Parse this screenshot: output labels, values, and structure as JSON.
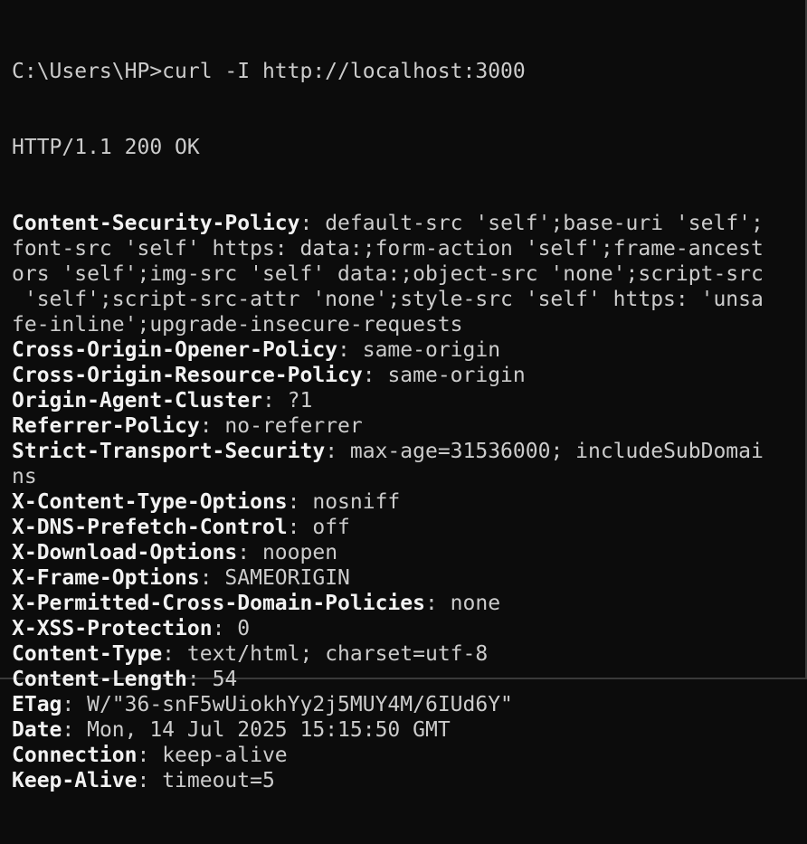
{
  "terminal": {
    "command_line": "C:\\Users\\HP>curl -I http://localhost:3000",
    "status_line": "HTTP/1.1 200 OK",
    "headers": [
      {
        "key": "Content-Security-Policy",
        "sep": ": ",
        "lines": [
          "default-src 'self';base-uri 'self';",
          "font-src 'self' https: data:;form-action 'self';frame-ancest",
          "ors 'self';img-src 'self' data:;object-src 'none';script-src",
          " 'self';script-src-attr 'none';style-src 'self' https: 'unsa",
          "fe-inline';upgrade-insecure-requests"
        ]
      },
      {
        "key": "Cross-Origin-Opener-Policy",
        "sep": ": ",
        "lines": [
          "same-origin"
        ]
      },
      {
        "key": "Cross-Origin-Resource-Policy",
        "sep": ": ",
        "lines": [
          "same-origin"
        ]
      },
      {
        "key": "Origin-Agent-Cluster",
        "sep": ": ",
        "lines": [
          "?1"
        ]
      },
      {
        "key": "Referrer-Policy",
        "sep": ": ",
        "lines": [
          "no-referrer"
        ]
      },
      {
        "key": "Strict-Transport-Security",
        "sep": ": ",
        "lines": [
          "max-age=31536000; includeSubDomai",
          "ns"
        ]
      },
      {
        "key": "X-Content-Type-Options",
        "sep": ": ",
        "lines": [
          "nosniff"
        ]
      },
      {
        "key": "X-DNS-Prefetch-Control",
        "sep": ": ",
        "lines": [
          "off"
        ]
      },
      {
        "key": "X-Download-Options",
        "sep": ": ",
        "lines": [
          "noopen"
        ]
      },
      {
        "key": "X-Frame-Options",
        "sep": ": ",
        "lines": [
          "SAMEORIGIN"
        ]
      },
      {
        "key": "X-Permitted-Cross-Domain-Policies",
        "sep": ": ",
        "lines": [
          "none"
        ]
      },
      {
        "key": "X-XSS-Protection",
        "sep": ": ",
        "lines": [
          "0"
        ]
      },
      {
        "key": "Content-Type",
        "sep": ": ",
        "lines": [
          "text/html; charset=utf-8"
        ]
      },
      {
        "key": "Content-Length",
        "sep": ": ",
        "lines": [
          "54"
        ]
      },
      {
        "key": "ETag",
        "sep": ": ",
        "lines": [
          "W/\"36-snF5wUiokhYy2j5MUY4M/6IUd6Y\""
        ]
      },
      {
        "key": "Date",
        "sep": ": ",
        "lines": [
          "Mon, 14 Jul 2025 15:15:50 GMT"
        ]
      },
      {
        "key": "Connection",
        "sep": ": ",
        "lines": [
          "keep-alive"
        ]
      },
      {
        "key": "Keep-Alive",
        "sep": ": ",
        "lines": [
          "timeout=5"
        ]
      }
    ]
  },
  "colors": {
    "background": "#0c0c0c",
    "text": "#cccccc",
    "header_key": "#f2f2f2"
  }
}
